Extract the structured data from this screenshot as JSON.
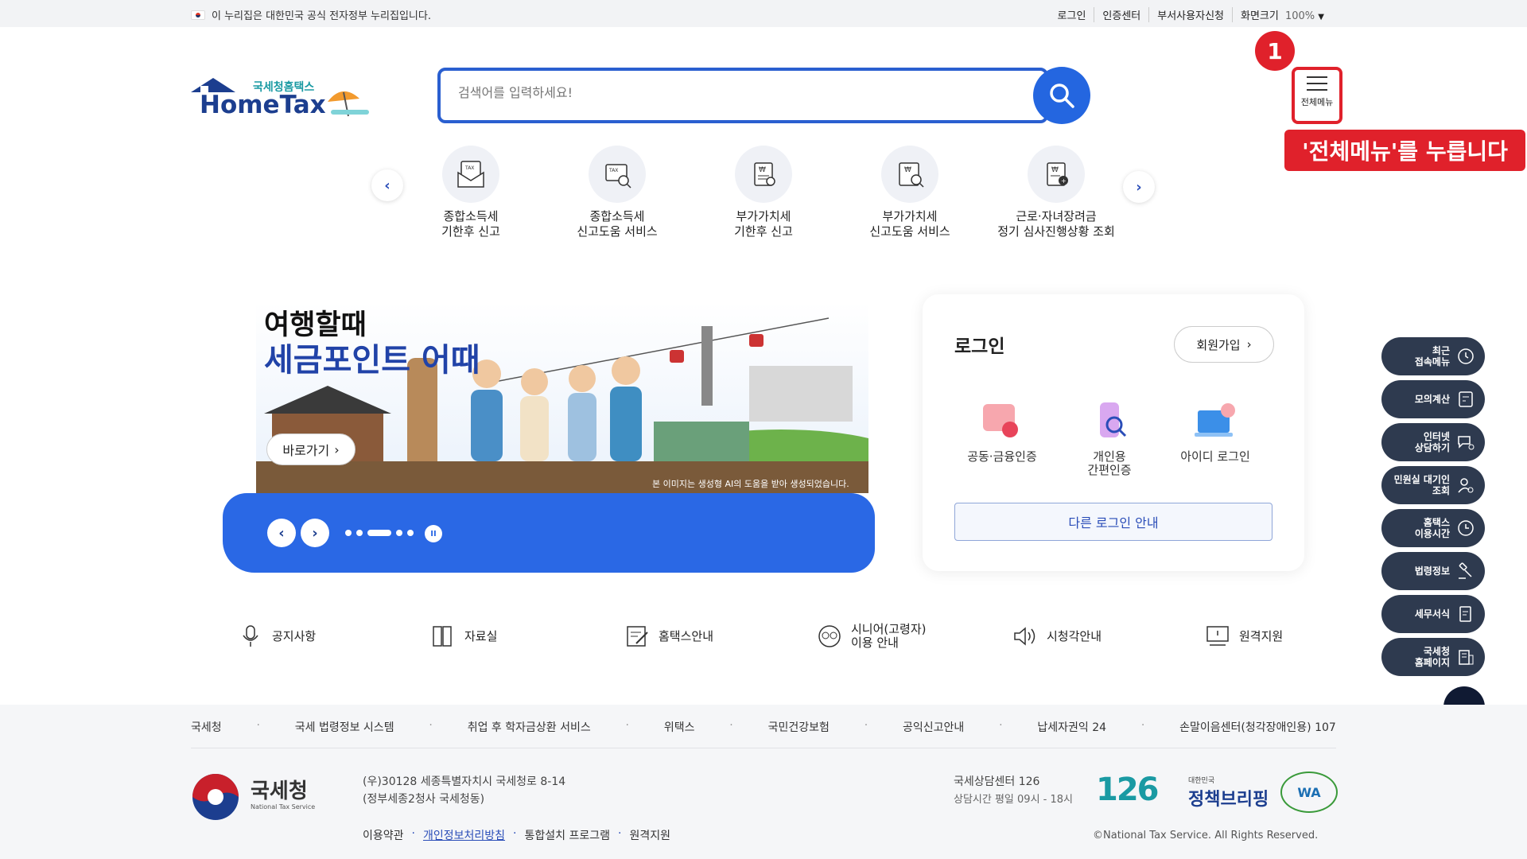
{
  "topbar": {
    "notice": "이 누리집은 대한민국 공식 전자정부 누리집입니다.",
    "links": [
      "로그인",
      "인증센터",
      "부서사용자신청",
      "화면크기"
    ],
    "zoom": "100%"
  },
  "logo": {
    "small": "국세청홈택스",
    "big": "HomeTax"
  },
  "search": {
    "placeholder": "검색어를 입력하세요!"
  },
  "menu": {
    "badge": "1",
    "label": "전체메뉴",
    "tip": "'전체메뉴'를 누릅니다"
  },
  "quick": [
    {
      "l1": "종합소득세",
      "l2": "기한후 신고"
    },
    {
      "l1": "종합소득세",
      "l2": "신고도움 서비스"
    },
    {
      "l1": "부가가치세",
      "l2": "기한후 신고"
    },
    {
      "l1": "부가가치세",
      "l2": "신고도움 서비스"
    },
    {
      "l1": "근로·자녀장려금",
      "l2": "정기 심사진행상황 조회"
    }
  ],
  "banner": {
    "line1": "여행할때",
    "line2": "세금포인트 어때",
    "go": "바로가기",
    "ai_note": "본 이미지는 생성형 AI의 도움을 받아 생성되었습니다."
  },
  "login": {
    "title": "로그인",
    "join": "회원가입",
    "options": [
      {
        "l1": "공동·금융인증",
        "l2": ""
      },
      {
        "l1": "개인용",
        "l2": "간편인증"
      },
      {
        "l1": "아이디 로그인",
        "l2": ""
      }
    ],
    "other": "다른 로그인 안내"
  },
  "links": [
    {
      "l1": "공지사항",
      "l2": ""
    },
    {
      "l1": "자료실",
      "l2": ""
    },
    {
      "l1": "홈택스안내",
      "l2": ""
    },
    {
      "l1": "시니어(고령자)",
      "l2": "이용 안내"
    },
    {
      "l1": "시청각안내",
      "l2": ""
    },
    {
      "l1": "원격지원",
      "l2": ""
    }
  ],
  "side": [
    {
      "l1": "최근",
      "l2": "접속메뉴"
    },
    {
      "l1": "모의계산",
      "l2": ""
    },
    {
      "l1": "인터넷",
      "l2": "상담하기"
    },
    {
      "l1": "민원실 대기인",
      "l2": "조회"
    },
    {
      "l1": "홈택스",
      "l2": "이용시간"
    },
    {
      "l1": "법령정보",
      "l2": ""
    },
    {
      "l1": "세무서식",
      "l2": ""
    },
    {
      "l1": "국세청",
      "l2": "홈페이지"
    }
  ],
  "footer": {
    "links": [
      "국세청",
      "국세 법령정보 시스템",
      "취업 후 학자금상환 서비스",
      "위택스",
      "국민건강보험",
      "공익신고안내",
      "납세자권익 24",
      "손말이음센터(청각장애인용) 107"
    ],
    "nts_name": "국세청",
    "nts_sub": "National Tax Service",
    "addr1": "(우)30128 세종특별자치시 국세청로 8-14",
    "addr2": "(정부세종2청사 국세청동)",
    "bottom": [
      "이용약관",
      "개인정보처리방침",
      "통합설치 프로그램",
      "원격지원"
    ],
    "cs1": "국세상담센터 126",
    "cs2": "상담시간 평일 09시 - 18시",
    "copyright": "©National Tax Service. All Rights Reserved.",
    "logo126": "126",
    "brief_small": "대한민국",
    "brief_big": "정책브리핑",
    "wa": "WA"
  }
}
